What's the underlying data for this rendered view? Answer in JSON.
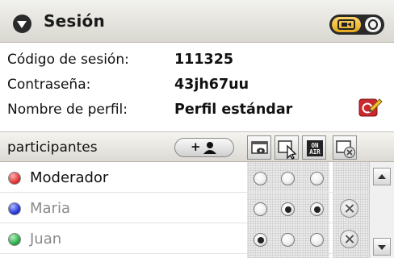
{
  "header": {
    "title": "Sesión",
    "collapse_icon": "chevron-down-icon",
    "toggle": {
      "left_icon": "screen-share-icon",
      "right_icon": "record-icon"
    }
  },
  "info": {
    "session_code_label": "Código de sesión:",
    "session_code_value": "111325",
    "password_label": "Contraseña:",
    "password_value": "43jh67uu",
    "profile_label": "Nombre de perfil:",
    "profile_value": "Perfil estándar",
    "edit_icon": "edit-profile-icon"
  },
  "participants": {
    "title": "participantes",
    "add_button_label": "+",
    "add_button_icon": "add-person-icon",
    "column_icons": [
      "presenter-screen-icon",
      "pointer-control-icon",
      "on-air-icon",
      "remove-screen-icon"
    ],
    "on_air_text": "ON AIR",
    "rows": [
      {
        "name": "Moderador",
        "color": "#e03a3a",
        "name_color": "#111111",
        "radios": [
          false,
          false,
          false
        ],
        "removable": false
      },
      {
        "name": "Maria",
        "color": "#2a3ad9",
        "name_color": "#8a8a8a",
        "radios": [
          false,
          true,
          true
        ],
        "removable": true
      },
      {
        "name": "Juan",
        "color": "#2fae4a",
        "name_color": "#8a8a8a",
        "radios": [
          true,
          false,
          false
        ],
        "removable": true
      }
    ]
  },
  "colors": {
    "accent_toggle": "#f0b42a",
    "edit_icon_color": "#c8282e"
  }
}
